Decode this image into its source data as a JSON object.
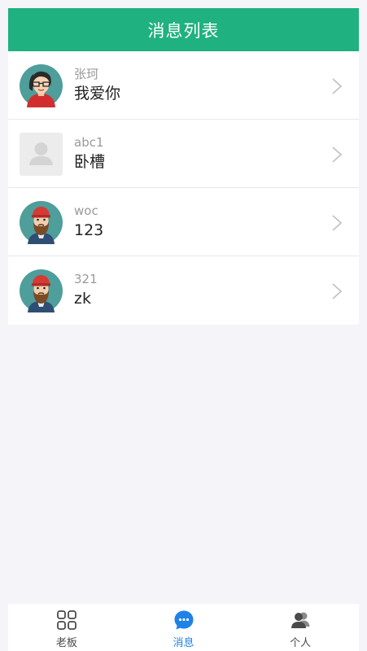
{
  "header": {
    "title": "消息列表"
  },
  "messages": [
    {
      "name": "张珂",
      "content": "我爱你",
      "avatar": "woman-avatar-icon"
    },
    {
      "name": "abc1",
      "content": "卧槽",
      "avatar": "default-avatar-icon"
    },
    {
      "name": "woc",
      "content": "123",
      "avatar": "bearded-man-avatar-icon"
    },
    {
      "name": "321",
      "content": "zk",
      "avatar": "bearded-man-avatar-icon"
    }
  ],
  "tabbar": {
    "tabs": [
      {
        "label": "老板",
        "icon": "grid-icon",
        "active": false
      },
      {
        "label": "消息",
        "icon": "chat-bubble-icon",
        "active": true
      },
      {
        "label": "个人",
        "icon": "people-icon",
        "active": false
      }
    ]
  },
  "colors": {
    "header_bg": "#1fb180",
    "active_tab": "#1e82e6",
    "page_bg": "#f4f4f9"
  }
}
